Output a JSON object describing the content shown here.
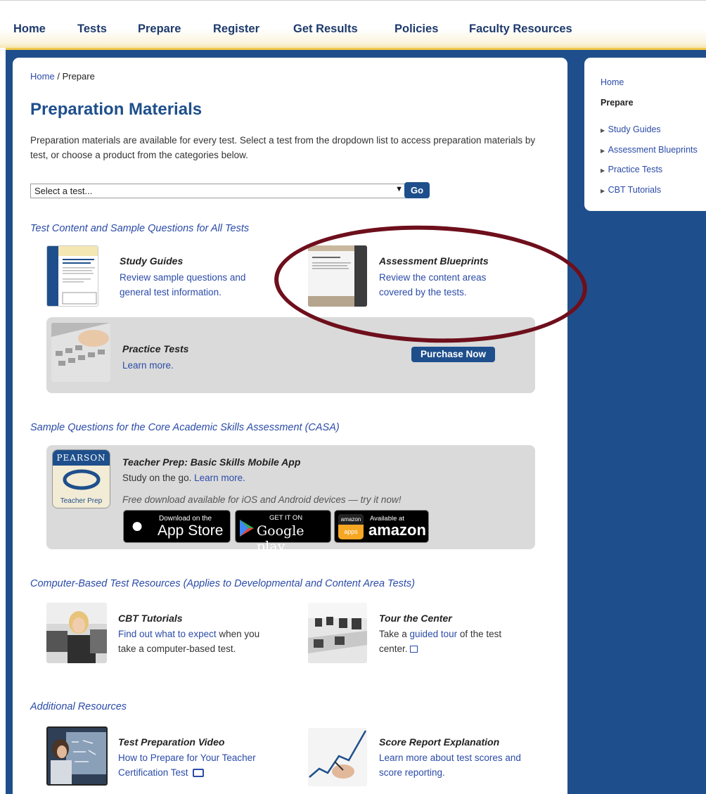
{
  "nav": {
    "items": [
      "Home",
      "Tests",
      "Prepare",
      "Register",
      "Get Results",
      "Policies",
      "Faculty Resources"
    ]
  },
  "breadcrumb": {
    "home": "Home",
    "separator": "/",
    "current": "Prepare"
  },
  "page_title": "Preparation Materials",
  "intro": "Preparation materials are available for every test. Select a test from the dropdown list to access preparation materials by test, or choose a product from the categories below.",
  "test_select": {
    "value": "Select a test...",
    "go_label": "Go"
  },
  "section1": {
    "heading": "Test Content and Sample Questions for All Tests",
    "study_guides": {
      "title": "Study Guides",
      "text": "Review sample questions and general test information."
    },
    "assessment_blueprints": {
      "title": "Assessment Blueprints",
      "text": "Review the content areas covered by the tests."
    },
    "practice_tests": {
      "title": "Practice Tests",
      "link": "Learn more.",
      "purchase_label": "Purchase Now"
    }
  },
  "section2": {
    "heading": "Sample Questions for the Core Academic Skills Assessment (CASA)",
    "app": {
      "icon_top": "PEARSON",
      "icon_bottom": "Teacher Prep",
      "title": "Teacher Prep: Basic Skills Mobile App",
      "subtitle_plain": "Study on the go.",
      "subtitle_link": "Learn more.",
      "download_text": "Free download available for iOS and Android devices — try it now!",
      "appstore_small": "Download on the",
      "appstore_big": "App Store",
      "google_small": "GET IT ON",
      "google_big": "Google play",
      "amazon_badge_top": "amazon",
      "amazon_badge_bottom": "apps",
      "amazon_small": "Available at",
      "amazon_big": "amazon"
    }
  },
  "section3": {
    "heading": "Computer-Based Test Resources (Applies to Developmental and Content Area Tests)",
    "cbt": {
      "title": "CBT Tutorials",
      "link": "Find out what to expect",
      "rest": "when you take a computer-based test."
    },
    "tour": {
      "title": "Tour the Center",
      "pre": "Take a",
      "link": "guided tour",
      "post": "of the test center."
    }
  },
  "section4": {
    "heading": "Additional Resources",
    "video": {
      "title": "Test Preparation Video",
      "text": "How to Prepare for Your Teacher Certification Test"
    },
    "score": {
      "title": "Score Report Explanation",
      "text": "Learn more about test scores and score reporting."
    }
  },
  "sidebar": {
    "home": "Home",
    "section": "Prepare",
    "items": [
      "Study Guides",
      "Assessment Blueprints",
      "Practice Tests",
      "CBT Tutorials"
    ]
  },
  "colors": {
    "brand_blue": "#1e4f8c",
    "link_blue": "#2b4ba8",
    "accent_gold": "#f2c94c",
    "ellipse_maroon": "#6e0f1c"
  }
}
